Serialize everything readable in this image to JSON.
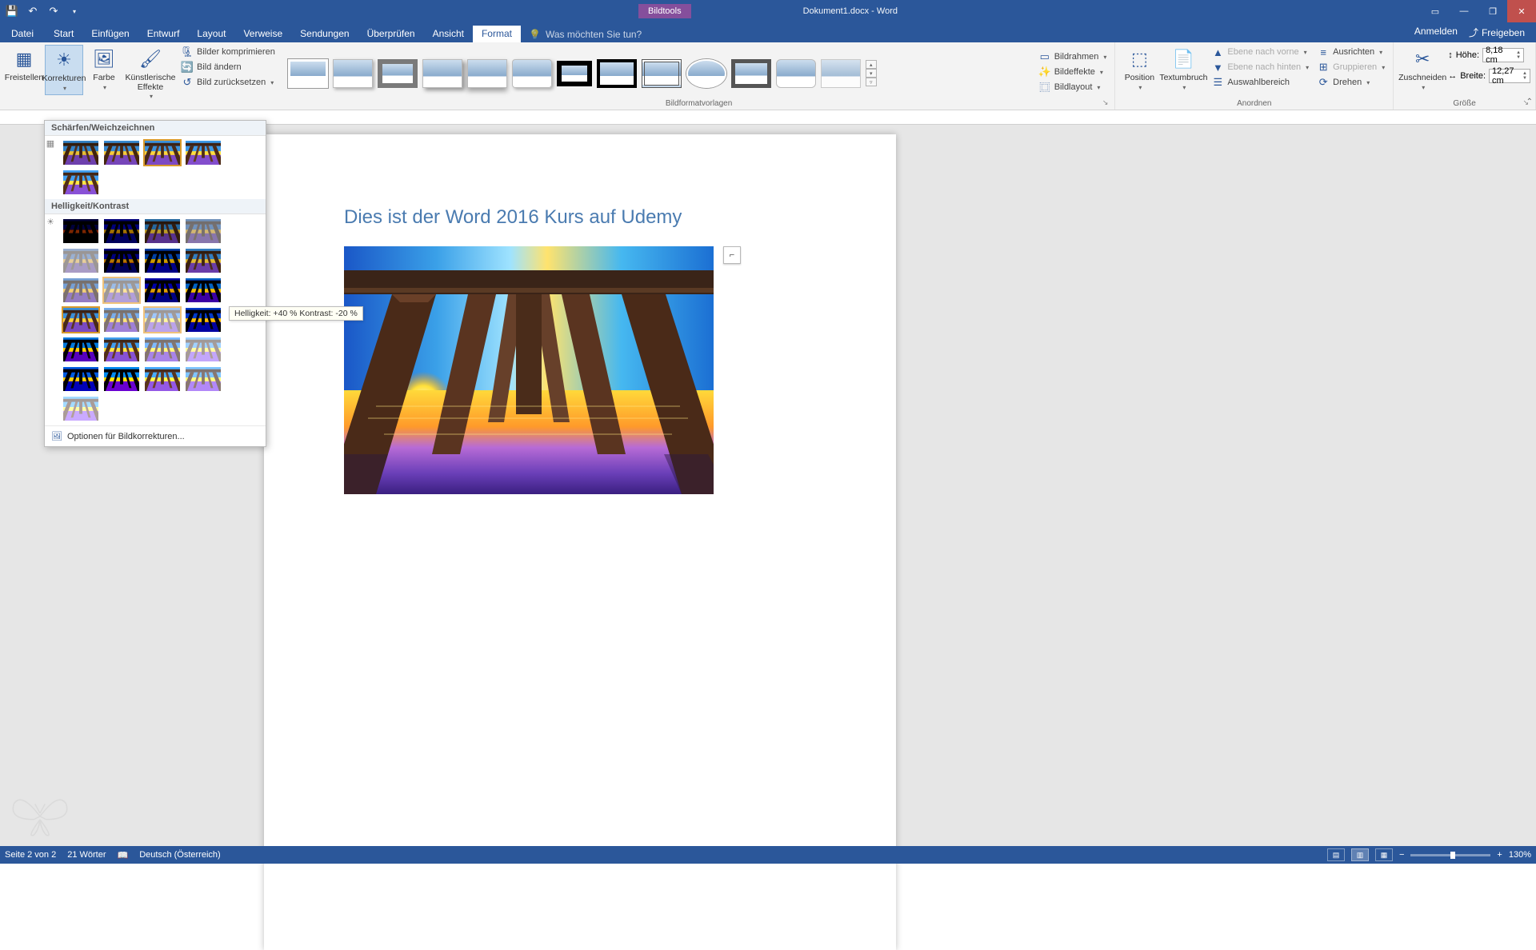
{
  "titlebar": {
    "contextual_tab": "Bildtools",
    "doc": "Dokument1.docx - Word"
  },
  "menubar": {
    "file": "Datei",
    "tabs": [
      "Start",
      "Einfügen",
      "Entwurf",
      "Layout",
      "Verweise",
      "Sendungen",
      "Überprüfen",
      "Ansicht",
      "Format"
    ],
    "active_tab": "Format",
    "tellme_placeholder": "Was möchten Sie tun?",
    "signin": "Anmelden",
    "share": "Freigeben"
  },
  "ribbon": {
    "freistellen": "Freistellen",
    "korrekturen": "Korrekturen",
    "farbe": "Farbe",
    "kunst": "Künstlerische Effekte",
    "compress": "Bilder komprimieren",
    "change": "Bild ändern",
    "reset": "Bild zurücksetzen",
    "styles_label": "Bildformatvorlagen",
    "border": "Bildrahmen",
    "effects": "Bildeffekte",
    "layout": "Bildlayout",
    "position": "Position",
    "wrap": "Textumbruch",
    "forward": "Ebene nach vorne",
    "backward": "Ebene nach hinten",
    "selpane": "Auswahlbereich",
    "align": "Ausrichten",
    "group": "Gruppieren",
    "rotate": "Drehen",
    "arrange_label": "Anordnen",
    "crop": "Zuschneiden",
    "height_lbl": "Höhe:",
    "width_lbl": "Breite:",
    "height_val": "8,18 cm",
    "width_val": "12,27 cm",
    "size_label": "Größe"
  },
  "corrections": {
    "sharp_header": "Schärfen/Weichzeichnen",
    "bc_header": "Helligkeit/Kontrast",
    "options": "Optionen für Bildkorrekturen...",
    "tooltip": "Helligkeit: +40 % Kontrast: -20 %"
  },
  "document": {
    "heading": "Dies ist der Word 2016 Kurs auf Udemy"
  },
  "statusbar": {
    "page": "Seite 2 von 2",
    "words": "21 Wörter",
    "lang": "Deutsch (Österreich)",
    "zoom": "130%"
  }
}
